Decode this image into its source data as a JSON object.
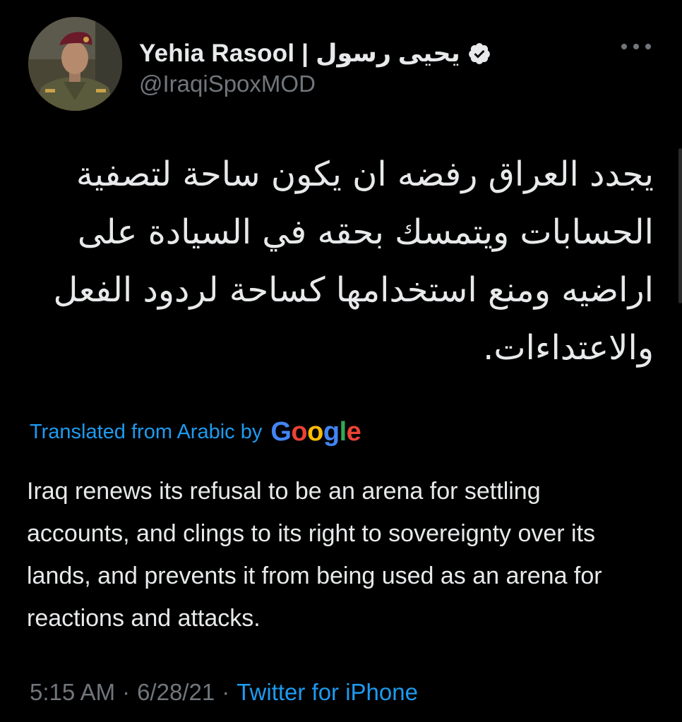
{
  "tweet": {
    "author": {
      "display_name": "Yehia Rasool | يحيى رسول",
      "handle": "@IraqiSpoxMOD",
      "verified": true
    },
    "text_arabic": "يجدد العراق رفضه ان يكون ساحة لتصفية الحسابات ويتمسك بحقه في السيادة على اراضيه ومنع استخدامها كساحة لردود الفعل والاعتداءات.",
    "translation": {
      "label": "Translated from Arabic by",
      "provider_letters": [
        {
          "ch": "G",
          "color": "#4285F4"
        },
        {
          "ch": "o",
          "color": "#EA4335"
        },
        {
          "ch": "o",
          "color": "#FBBC05"
        },
        {
          "ch": "g",
          "color": "#4285F4"
        },
        {
          "ch": "l",
          "color": "#34A853"
        },
        {
          "ch": "e",
          "color": "#EA4335"
        }
      ],
      "text": "Iraq renews its refusal to be an arena for settling accounts, and clings to its right to sovereignty over its lands, and prevents it from being used as an arena for reactions and attacks."
    },
    "meta": {
      "time": "5:15 AM",
      "separator": "·",
      "date": "6/28/21",
      "source": "Twitter for iPhone"
    }
  },
  "icons": {
    "more": "more-horizontal-icon",
    "verified": "verified-badge-icon"
  },
  "colors": {
    "background": "#000000",
    "text_primary": "#e7e9ea",
    "text_secondary": "#71767b",
    "link": "#1d9bf0"
  }
}
